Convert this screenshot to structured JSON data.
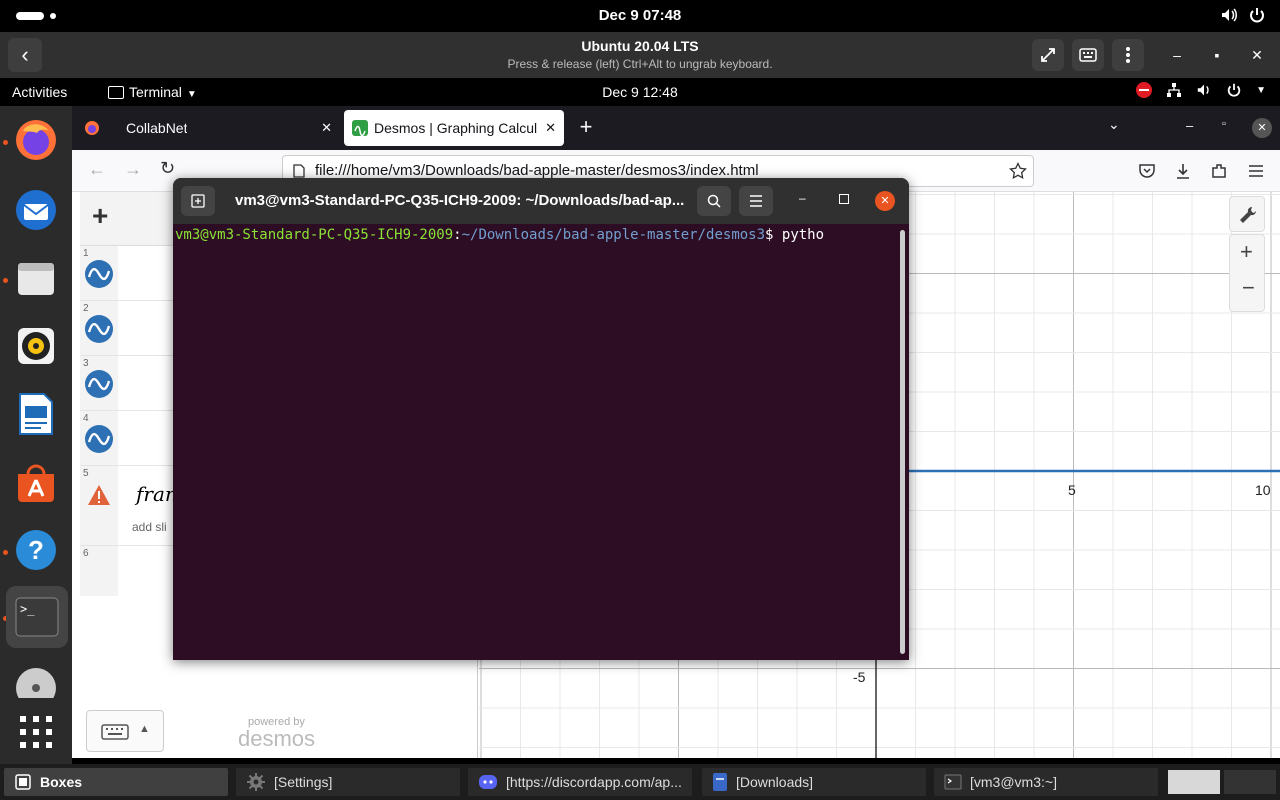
{
  "host_top": {
    "clock": "Dec 9  07:48"
  },
  "boxes": {
    "title": "Ubuntu 20.04 LTS",
    "subtitle": "Press & release (left) Ctrl+Alt to ungrab keyboard."
  },
  "guest_panel": {
    "activities": "Activities",
    "app_menu": "Terminal",
    "clock": "Dec 9  12:48"
  },
  "firefox": {
    "tabs": [
      {
        "label": "CollabNet"
      },
      {
        "label": "Desmos | Graphing Calcul"
      }
    ],
    "url": "file:///home/vm3/Downloads/bad-apple-master/desmos3/index.html"
  },
  "desmos": {
    "rows": [
      "1",
      "2",
      "3",
      "4",
      "5",
      "6"
    ],
    "row5_expr": "fran",
    "row5_hint": "add sli",
    "powered_by": "powered by",
    "brand": "desmos",
    "axis_labels": {
      "x5": "5",
      "x10": "10",
      "yneg5": "-5"
    }
  },
  "terminal": {
    "title": "vm3@vm3-Standard-PC-Q35-ICH9-2009: ~/Downloads/bad-ap...",
    "prompt_user": "vm3@vm3-Standard-PC-Q35-ICH9-2009",
    "prompt_sep": ":",
    "prompt_path": "~/Downloads/bad-apple-master/desmos3",
    "prompt_end": "$ ",
    "command": "pytho"
  },
  "taskbar": {
    "items": [
      {
        "label": "Boxes"
      },
      {
        "label": "[Settings]"
      },
      {
        "label": "[https://discordapp.com/ap..."
      },
      {
        "label": "[Downloads]"
      },
      {
        "label": "[vm3@vm3:~]"
      }
    ]
  }
}
